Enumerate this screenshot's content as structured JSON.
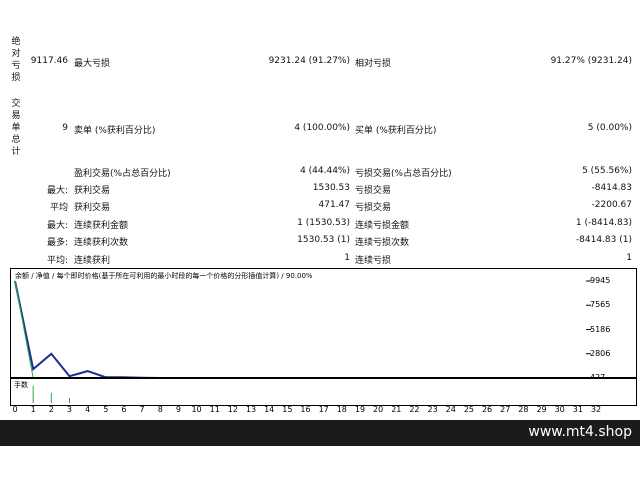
{
  "stats": {
    "abs_drawdown_label": "绝对亏损",
    "abs_drawdown_value": "9117.46",
    "max_drawdown_label": "最大亏损",
    "max_drawdown_value": "9231.24 (91.27%)",
    "rel_drawdown_label": "相对亏损",
    "rel_drawdown_value": "91.27% (9231.24)",
    "total_trades_label": "交易单总计",
    "total_trades_value": "9",
    "short_label": "卖单 (%获利百分比)",
    "short_value": "4 (100.00%)",
    "long_label": "买单 (%获利百分比)",
    "long_value": "5 (0.00%)",
    "profit_trades_label": "盈利交易(%占总百分比)",
    "profit_trades_value": "4 (44.44%)",
    "loss_trades_label": "亏损交易(%占总百分比)",
    "loss_trades_value": "5 (55.56%)",
    "largest_prefix": "最大:",
    "largest_profit_label": "获利交易",
    "largest_profit_value": "1530.53",
    "largest_loss_label": "亏损交易",
    "largest_loss_value": "-8414.83",
    "average_prefix": "平均",
    "avg_profit_label": "获利交易",
    "avg_profit_value": "471.47",
    "avg_loss_label": "亏损交易",
    "avg_loss_value": "-2200.67",
    "max_prefix": "最大:",
    "max_consec_wins_amount_label": "连续获利金额",
    "max_consec_wins_amount_value": "1 (1530.53)",
    "max_consec_loss_amount_label": "连续亏损金额",
    "max_consec_loss_amount_value": "1 (-8414.83)",
    "maximal_prefix": "最多:",
    "max_consec_profit_count_label": "连续获利次数",
    "max_consec_profit_count_value": "1530.53 (1)",
    "max_consec_loss_count_label": "连续亏损次数",
    "max_consec_loss_count_value": "-8414.83 (1)",
    "avg2_prefix": "平均:",
    "avg_consec_wins_label": "连续获利",
    "avg_consec_wins_value": "1",
    "avg_consec_losses_label": "连续亏损",
    "avg_consec_losses_value": "1"
  },
  "chart": {
    "legend": "余额 / 净值 / 每个即时价格(基于所在可利用的最小时段的每一个价格的分形插值计算) / 90.00%",
    "volume_label": "手数",
    "footer_brand": "www.mt4.shop"
  },
  "chart_data": {
    "type": "line",
    "series": [
      {
        "name": "余额",
        "color": "#1a2f8f",
        "x": [
          0,
          1,
          2,
          3,
          4,
          5,
          6,
          7,
          8,
          9
        ],
        "y": [
          9945,
          1300,
          2806,
          600,
          1100,
          500,
          500,
          450,
          427,
          427
        ]
      },
      {
        "name": "净值",
        "color": "#2aa84a",
        "x": [
          0,
          1,
          2,
          3,
          4,
          5,
          6,
          7,
          8,
          9
        ],
        "y": [
          9945,
          427,
          427,
          427,
          427,
          427,
          427,
          427,
          427,
          427
        ]
      }
    ],
    "y_ticks": [
      "9945",
      "7565",
      "5186",
      "2806",
      "427"
    ],
    "ylim": [
      427,
      9945
    ],
    "x_ticks": [
      "0",
      "1",
      "2",
      "3",
      "4",
      "5",
      "6",
      "7",
      "8",
      "9",
      "10",
      "11",
      "12",
      "13",
      "14",
      "15",
      "16",
      "17",
      "18",
      "19",
      "20",
      "21",
      "22",
      "23",
      "24",
      "25",
      "26",
      "27",
      "28",
      "29",
      "30",
      "31",
      "32"
    ],
    "xlim": [
      0,
      32
    ],
    "volume": {
      "x": [
        1,
        2,
        3
      ],
      "y": [
        1,
        0.6,
        0.3
      ],
      "color": "#2aa84a"
    }
  }
}
